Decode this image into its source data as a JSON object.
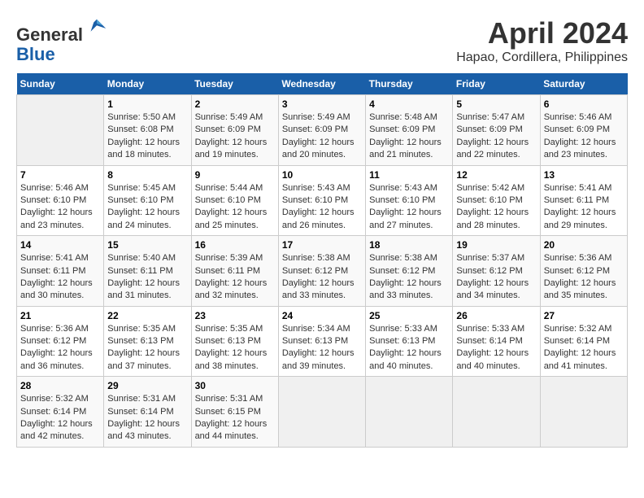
{
  "logo": {
    "general": "General",
    "blue": "Blue"
  },
  "title": "April 2024",
  "subtitle": "Hapao, Cordillera, Philippines",
  "days_of_week": [
    "Sunday",
    "Monday",
    "Tuesday",
    "Wednesday",
    "Thursday",
    "Friday",
    "Saturday"
  ],
  "weeks": [
    [
      {
        "day": "",
        "info": ""
      },
      {
        "day": "1",
        "info": "Sunrise: 5:50 AM\nSunset: 6:08 PM\nDaylight: 12 hours\nand 18 minutes."
      },
      {
        "day": "2",
        "info": "Sunrise: 5:49 AM\nSunset: 6:09 PM\nDaylight: 12 hours\nand 19 minutes."
      },
      {
        "day": "3",
        "info": "Sunrise: 5:49 AM\nSunset: 6:09 PM\nDaylight: 12 hours\nand 20 minutes."
      },
      {
        "day": "4",
        "info": "Sunrise: 5:48 AM\nSunset: 6:09 PM\nDaylight: 12 hours\nand 21 minutes."
      },
      {
        "day": "5",
        "info": "Sunrise: 5:47 AM\nSunset: 6:09 PM\nDaylight: 12 hours\nand 22 minutes."
      },
      {
        "day": "6",
        "info": "Sunrise: 5:46 AM\nSunset: 6:09 PM\nDaylight: 12 hours\nand 23 minutes."
      }
    ],
    [
      {
        "day": "7",
        "info": "Sunrise: 5:46 AM\nSunset: 6:10 PM\nDaylight: 12 hours\nand 23 minutes."
      },
      {
        "day": "8",
        "info": "Sunrise: 5:45 AM\nSunset: 6:10 PM\nDaylight: 12 hours\nand 24 minutes."
      },
      {
        "day": "9",
        "info": "Sunrise: 5:44 AM\nSunset: 6:10 PM\nDaylight: 12 hours\nand 25 minutes."
      },
      {
        "day": "10",
        "info": "Sunrise: 5:43 AM\nSunset: 6:10 PM\nDaylight: 12 hours\nand 26 minutes."
      },
      {
        "day": "11",
        "info": "Sunrise: 5:43 AM\nSunset: 6:10 PM\nDaylight: 12 hours\nand 27 minutes."
      },
      {
        "day": "12",
        "info": "Sunrise: 5:42 AM\nSunset: 6:10 PM\nDaylight: 12 hours\nand 28 minutes."
      },
      {
        "day": "13",
        "info": "Sunrise: 5:41 AM\nSunset: 6:11 PM\nDaylight: 12 hours\nand 29 minutes."
      }
    ],
    [
      {
        "day": "14",
        "info": "Sunrise: 5:41 AM\nSunset: 6:11 PM\nDaylight: 12 hours\nand 30 minutes."
      },
      {
        "day": "15",
        "info": "Sunrise: 5:40 AM\nSunset: 6:11 PM\nDaylight: 12 hours\nand 31 minutes."
      },
      {
        "day": "16",
        "info": "Sunrise: 5:39 AM\nSunset: 6:11 PM\nDaylight: 12 hours\nand 32 minutes."
      },
      {
        "day": "17",
        "info": "Sunrise: 5:38 AM\nSunset: 6:12 PM\nDaylight: 12 hours\nand 33 minutes."
      },
      {
        "day": "18",
        "info": "Sunrise: 5:38 AM\nSunset: 6:12 PM\nDaylight: 12 hours\nand 33 minutes."
      },
      {
        "day": "19",
        "info": "Sunrise: 5:37 AM\nSunset: 6:12 PM\nDaylight: 12 hours\nand 34 minutes."
      },
      {
        "day": "20",
        "info": "Sunrise: 5:36 AM\nSunset: 6:12 PM\nDaylight: 12 hours\nand 35 minutes."
      }
    ],
    [
      {
        "day": "21",
        "info": "Sunrise: 5:36 AM\nSunset: 6:12 PM\nDaylight: 12 hours\nand 36 minutes."
      },
      {
        "day": "22",
        "info": "Sunrise: 5:35 AM\nSunset: 6:13 PM\nDaylight: 12 hours\nand 37 minutes."
      },
      {
        "day": "23",
        "info": "Sunrise: 5:35 AM\nSunset: 6:13 PM\nDaylight: 12 hours\nand 38 minutes."
      },
      {
        "day": "24",
        "info": "Sunrise: 5:34 AM\nSunset: 6:13 PM\nDaylight: 12 hours\nand 39 minutes."
      },
      {
        "day": "25",
        "info": "Sunrise: 5:33 AM\nSunset: 6:13 PM\nDaylight: 12 hours\nand 40 minutes."
      },
      {
        "day": "26",
        "info": "Sunrise: 5:33 AM\nSunset: 6:14 PM\nDaylight: 12 hours\nand 40 minutes."
      },
      {
        "day": "27",
        "info": "Sunrise: 5:32 AM\nSunset: 6:14 PM\nDaylight: 12 hours\nand 41 minutes."
      }
    ],
    [
      {
        "day": "28",
        "info": "Sunrise: 5:32 AM\nSunset: 6:14 PM\nDaylight: 12 hours\nand 42 minutes."
      },
      {
        "day": "29",
        "info": "Sunrise: 5:31 AM\nSunset: 6:14 PM\nDaylight: 12 hours\nand 43 minutes."
      },
      {
        "day": "30",
        "info": "Sunrise: 5:31 AM\nSunset: 6:15 PM\nDaylight: 12 hours\nand 44 minutes."
      },
      {
        "day": "",
        "info": ""
      },
      {
        "day": "",
        "info": ""
      },
      {
        "day": "",
        "info": ""
      },
      {
        "day": "",
        "info": ""
      }
    ]
  ]
}
